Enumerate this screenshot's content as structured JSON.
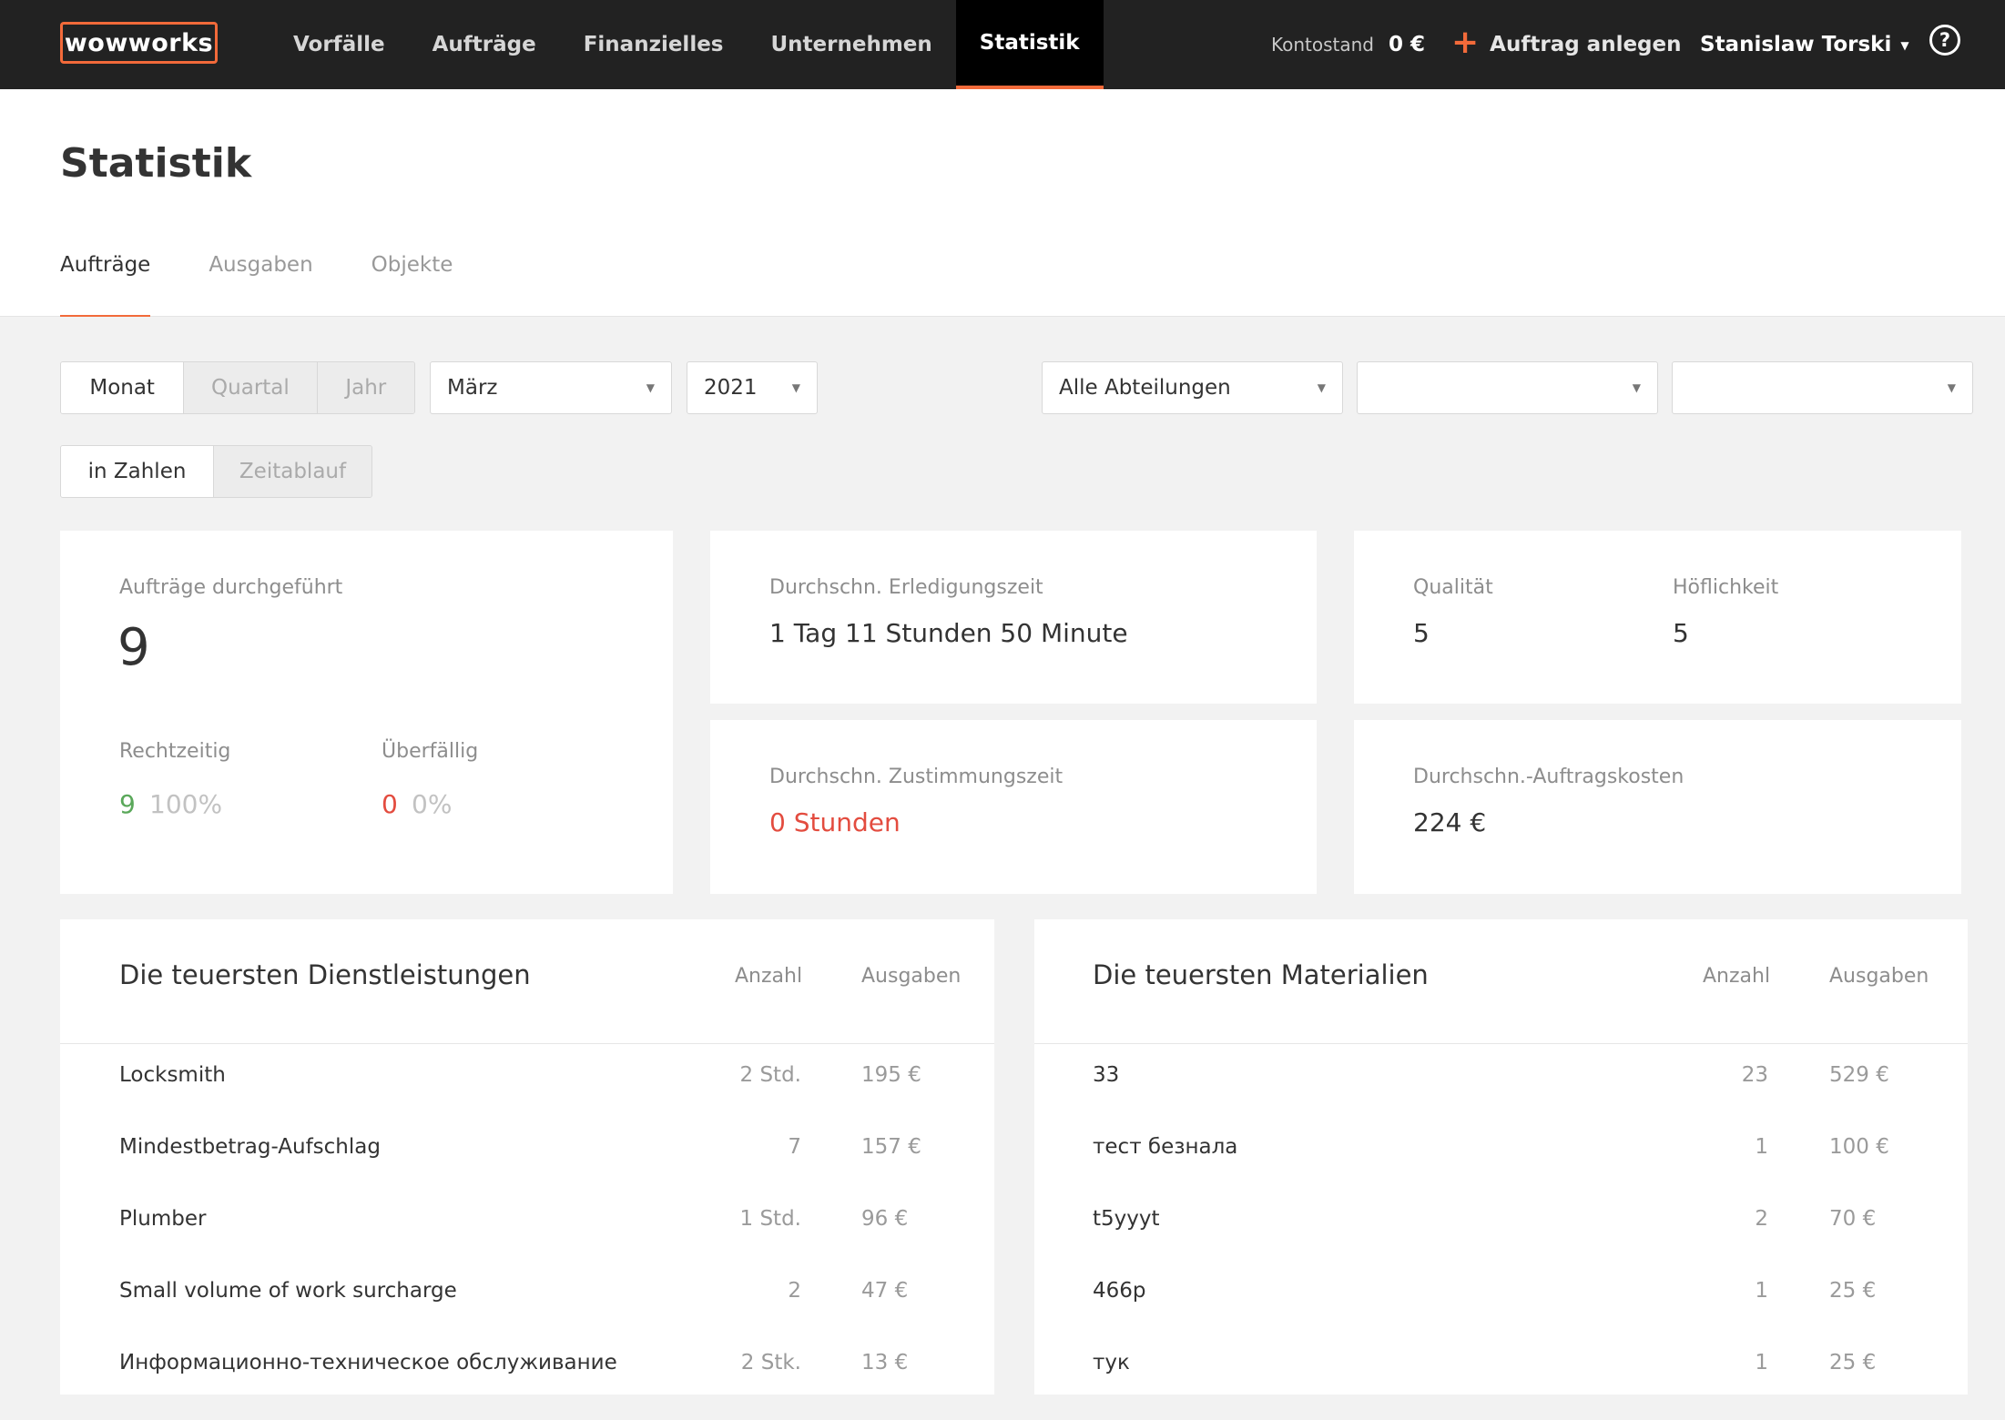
{
  "app": {
    "logo": "wowworks",
    "nav": [
      "Vorfälle",
      "Aufträge",
      "Finanzielles",
      "Unternehmen",
      "Statistik"
    ],
    "balance_label": "Kontostand",
    "balance_value": "0 €",
    "create_order": "Auftrag anlegen",
    "user_name": "Stanislaw Torski",
    "help": "?",
    "accent": "#f26a3a"
  },
  "page": {
    "title": "Statistik",
    "tabs": [
      "Aufträge",
      "Ausgaben",
      "Objekte"
    ]
  },
  "filters": {
    "period": [
      "Monat",
      "Quartal",
      "Jahr"
    ],
    "month": "März",
    "year": "2021",
    "department": "Alle Abteilungen",
    "select2": "",
    "select3": "",
    "view": [
      "in Zahlen",
      "Zeitablauf"
    ]
  },
  "stats": {
    "orders_done_label": "Aufträge durchgeführt",
    "orders_done_value": "9",
    "ontime_label": "Rechtzeitig",
    "ontime_count": "9",
    "ontime_pct": "100%",
    "overdue_label": "Überfällig",
    "overdue_count": "0",
    "overdue_pct": "0%",
    "avg_completion_label": "Durchschn. Erledigungszeit",
    "avg_completion_value": "1 Tag 11 Stunden 50 Minute",
    "quality_label": "Qualität",
    "quality_value": "5",
    "politeness_label": "Höflichkeit",
    "politeness_value": "5",
    "avg_approval_label": "Durchschn. Zustimmungszeit",
    "avg_approval_value": "0 Stunden",
    "avg_cost_label": "Durchschn.-Auftragskosten",
    "avg_cost_value": "224 €"
  },
  "services": {
    "title": "Die teuersten Dienstleistungen",
    "col_qty": "Anzahl",
    "col_cost": "Ausgaben",
    "rows": [
      {
        "name": "Locksmith",
        "qty": "2 Std.",
        "cost": "195 €"
      },
      {
        "name": "Mindestbetrag-Aufschlag",
        "qty": "7",
        "cost": "157 €"
      },
      {
        "name": "Plumber",
        "qty": "1 Std.",
        "cost": "96 €"
      },
      {
        "name": "Small volume of work surcharge",
        "qty": "2",
        "cost": "47 €"
      },
      {
        "name": "Информационно-техническое обслуживание",
        "qty": "2 Stk.",
        "cost": "13 €"
      }
    ]
  },
  "materials": {
    "title": "Die teuersten Materialien",
    "col_qty": "Anzahl",
    "col_cost": "Ausgaben",
    "rows": [
      {
        "name": "33",
        "qty": "23",
        "cost": "529 €"
      },
      {
        "name": "тест безнала",
        "qty": "1",
        "cost": "100 €"
      },
      {
        "name": "t5yyyt",
        "qty": "2",
        "cost": "70 €"
      },
      {
        "name": "466р",
        "qty": "1",
        "cost": "25 €"
      },
      {
        "name": "тук",
        "qty": "1",
        "cost": "25 €"
      }
    ]
  }
}
